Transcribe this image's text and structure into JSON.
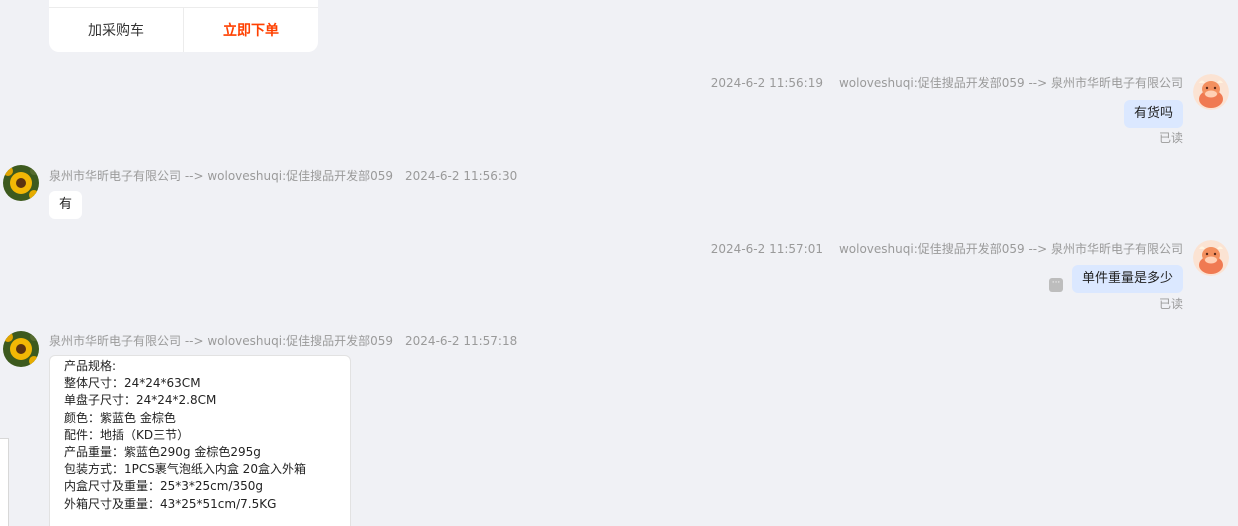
{
  "product_card": {
    "add_to_cart_label": "加采购车",
    "order_now_label": "立即下单",
    "order_color": "#ff4000"
  },
  "messages": [
    {
      "direction": "out",
      "time": "2024-6-2 11:56:19",
      "route": "woloveshuqi:促佳搜品开发部059 --> 泉州市华昕电子有限公司",
      "text": "有货吗",
      "status": "已读",
      "avatar_icon": "cow-avatar-icon"
    },
    {
      "direction": "in",
      "route": "泉州市华昕电子有限公司 --> woloveshuqi:促佳搜品开发部059",
      "time": "2024-6-2 11:56:30",
      "text": "有",
      "avatar_icon": "sunflower-avatar-icon"
    },
    {
      "direction": "out",
      "time": "2024-6-2 11:57:01",
      "route": "woloveshuqi:促佳搜品开发部059 --> 泉州市华昕电子有限公司",
      "text": "单件重量是多少",
      "status": "已读",
      "avatar_icon": "cow-avatar-icon"
    },
    {
      "direction": "in",
      "route": "泉州市华昕电子有限公司 --> woloveshuqi:促佳搜品开发部059",
      "time": "2024-6-2 11:57:18",
      "spec_lines": [
        "产品规格:",
        "整体尺寸：24*24*63CM",
        "单盘子尺寸：24*24*2.8CM",
        "颜色：紫蓝色 金棕色",
        "配件：地插（KD三节）",
        "产品重量：紫蓝色290g 金棕色295g",
        "包装方式：1PCS裹气泡纸入内盒  20盒入外箱",
        "内盒尺寸及重量：25*3*25cm/350g",
        "外箱尺寸及重量：43*25*51cm/7.5KG"
      ],
      "avatar_icon": "sunflower-avatar-icon"
    }
  ],
  "colors": {
    "background": "#f0f1f5",
    "outgoing_bubble": "#dbe8ff",
    "incoming_bubble": "#ffffff",
    "meta_text": "#9a9a9a"
  }
}
